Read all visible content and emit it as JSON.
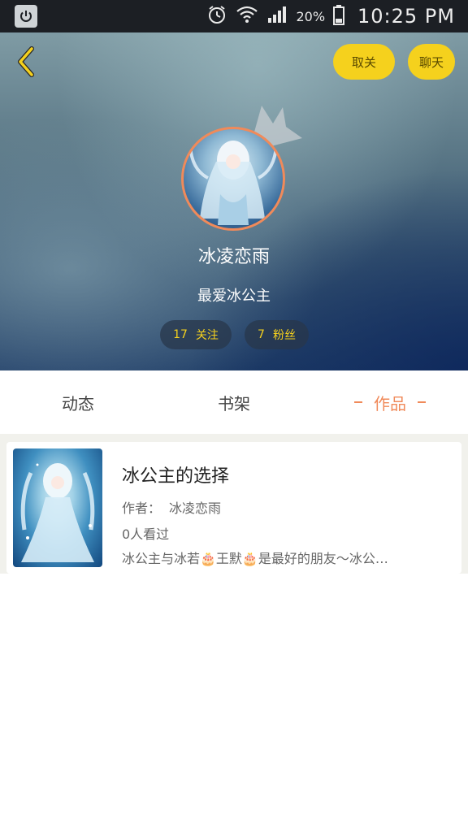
{
  "status_bar": {
    "battery_percent": "20%",
    "time": "10:25 PM",
    "icons": [
      "power-icon",
      "alarm-icon",
      "wifi-icon",
      "signal-icon",
      "battery-icon"
    ]
  },
  "header": {
    "back_icon": "chevron-left-icon",
    "unfollow_label": "取关",
    "chat_label": "聊天",
    "nickname": "冰凌恋雨",
    "signature": "最爱冰公主",
    "stats": {
      "following_count": "17",
      "following_label": "关注",
      "fans_count": "7",
      "fans_label": "粉丝"
    },
    "colors": {
      "accent_yellow": "#f5d11d",
      "avatar_border": "#f08a5a"
    }
  },
  "tabs": [
    {
      "label": "动态",
      "active": false
    },
    {
      "label": "书架",
      "active": false
    },
    {
      "label": "作品",
      "active": true
    }
  ],
  "works": [
    {
      "title": "冰公主的选择",
      "author_label": "作者：",
      "author": "冰凌恋雨",
      "readers": "0人看过",
      "description": "冰公主与冰若🎂王默🎂是最好的朋友～冰公…"
    }
  ]
}
